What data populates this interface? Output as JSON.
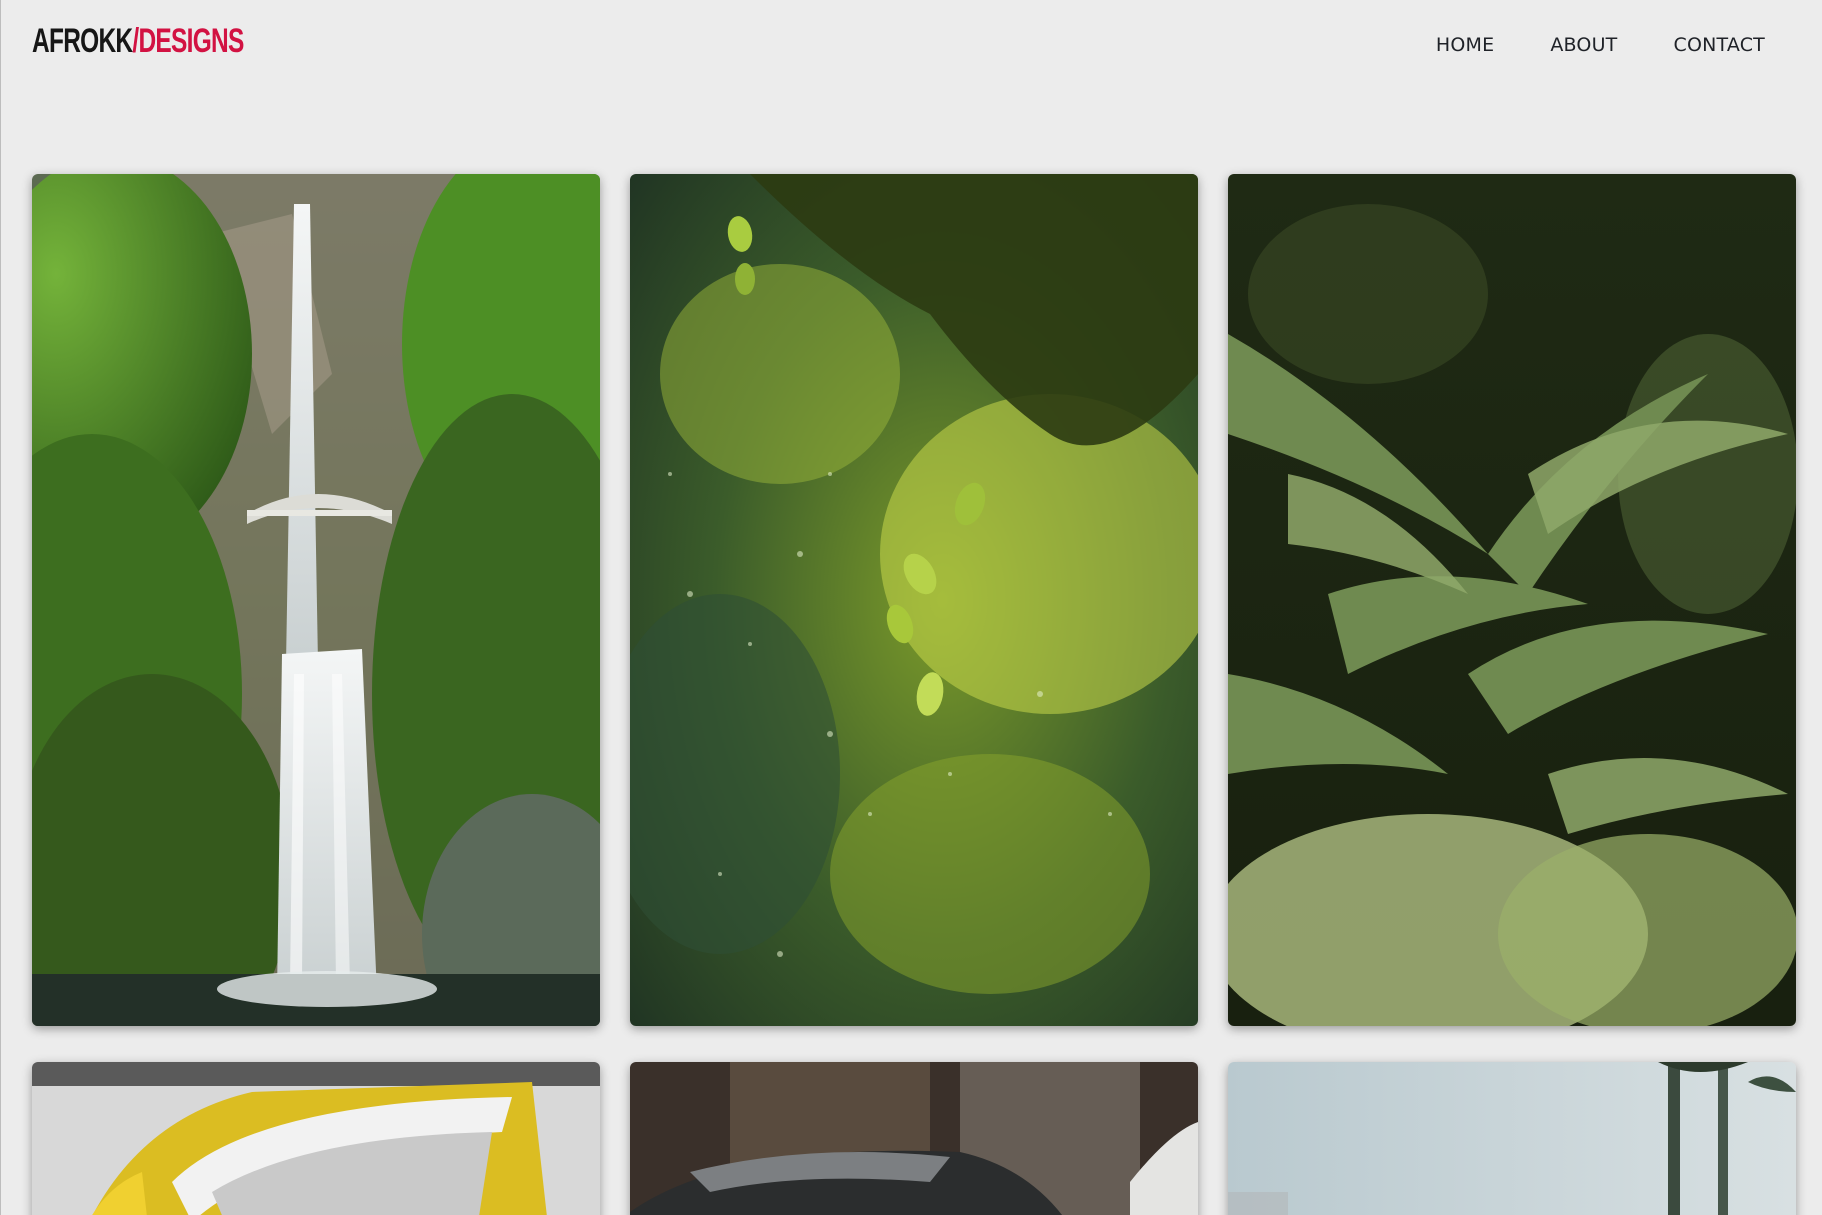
{
  "header": {
    "logo_primary": "AFROKK",
    "logo_accent": "/DESIGNS",
    "accent_color": "#d21242"
  },
  "nav": {
    "items": [
      {
        "label": "HOME"
      },
      {
        "label": "ABOUT"
      },
      {
        "label": "CONTACT"
      }
    ]
  },
  "gallery": {
    "photos": [
      {
        "subject": "waterfall with bridge in forest"
      },
      {
        "subject": "green leaves with bokeh"
      },
      {
        "subject": "tropical palm fronds"
      },
      {
        "subject": "yellow sports car"
      },
      {
        "subject": "silver car on city street"
      },
      {
        "subject": "palm trees against sky"
      }
    ]
  }
}
